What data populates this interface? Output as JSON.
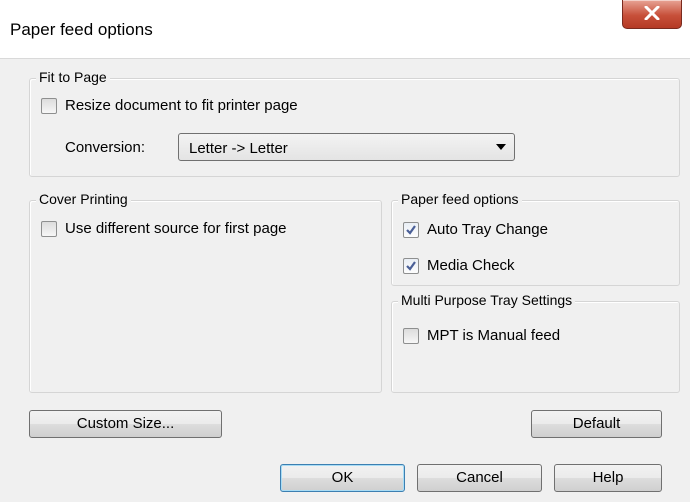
{
  "window": {
    "title": "Paper feed options",
    "close_icon": "close-icon"
  },
  "fit_to_page": {
    "title": "Fit to Page",
    "resize_label": "Resize document to fit printer page",
    "resize_checked": false,
    "conversion_label": "Conversion:",
    "conversion_value": "Letter -> Letter"
  },
  "cover_printing": {
    "title": "Cover Printing",
    "diff_source_label": "Use different source for first page",
    "diff_source_checked": false
  },
  "paper_feed": {
    "title": "Paper feed options",
    "auto_tray_label": "Auto Tray Change",
    "auto_tray_checked": true,
    "media_check_label": "Media Check",
    "media_check_checked": true
  },
  "mpt": {
    "title": "Multi Purpose Tray Settings",
    "manual_feed_label": "MPT is Manual feed",
    "manual_feed_checked": false
  },
  "buttons": {
    "custom_size": "Custom Size...",
    "default": "Default",
    "ok": "OK",
    "cancel": "Cancel",
    "help": "Help"
  }
}
